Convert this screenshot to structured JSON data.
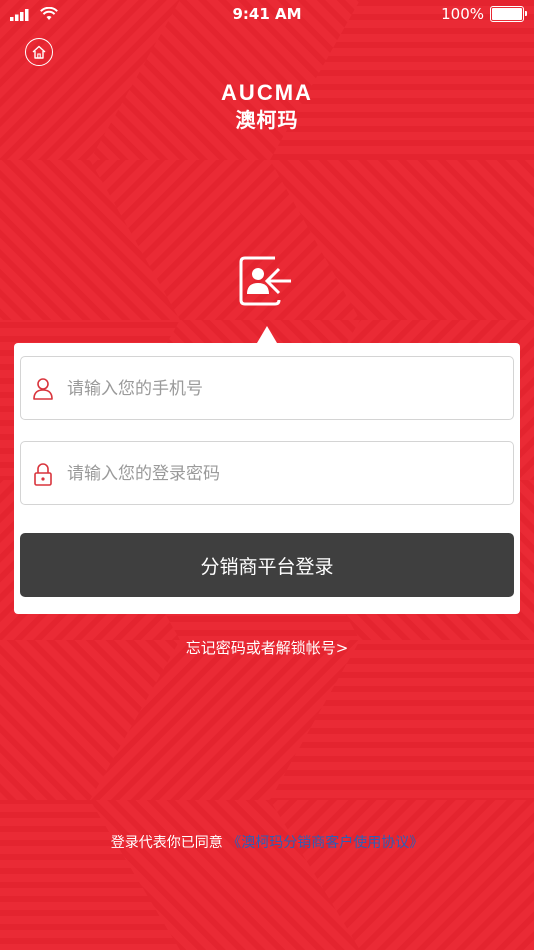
{
  "status_bar": {
    "time": "9:41 AM",
    "battery_text": "100%",
    "signal_icon": "signal-bars-icon",
    "wifi_icon": "wifi-icon",
    "battery_level": 1.0
  },
  "header": {
    "home_icon": "home-icon",
    "logo_en": "AUCMA",
    "logo_cn": "澳柯玛"
  },
  "login_icon": "contact-login-icon",
  "form": {
    "phone_placeholder": "请输入您的手机号",
    "phone_value": "",
    "phone_icon": "user-icon",
    "password_placeholder": "请输入您的登录密码",
    "password_value": "",
    "password_icon": "lock-icon",
    "submit_label": "分销商平台登录"
  },
  "forgot_link": "忘记密码或者解锁帐号>",
  "agreement": {
    "prefix": "登录代表你已同意",
    "link": "《澳柯玛分销商客户使用协议》"
  },
  "colors": {
    "background": "#ea2a35",
    "button": "#3f3f3f",
    "link": "#2c5fb8",
    "icon_red": "#d9343c"
  }
}
